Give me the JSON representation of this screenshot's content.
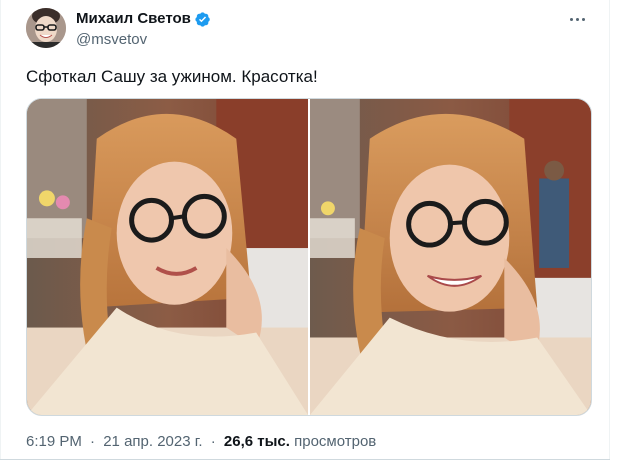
{
  "author": {
    "display_name": "Михаил Светов",
    "handle": "@msvetov",
    "verified_badge_color": "#1d9bf0",
    "avatar_icon": "avatar-photo"
  },
  "more_icon": "more-horizontal-icon",
  "tweet": {
    "text": "Сфоткал Сашу за ужином. Красотка!"
  },
  "media": {
    "photos": [
      {
        "icon": "photo-1"
      },
      {
        "icon": "photo-2"
      }
    ]
  },
  "meta": {
    "time": "6:19 PM",
    "separator": "·",
    "date": "21 апр. 2023 г.",
    "views_count": "26,6 тыс.",
    "views_label": "просмотров"
  },
  "colors": {
    "text_primary": "#0f1419",
    "text_secondary": "#536471",
    "border": "#cfd9de"
  }
}
